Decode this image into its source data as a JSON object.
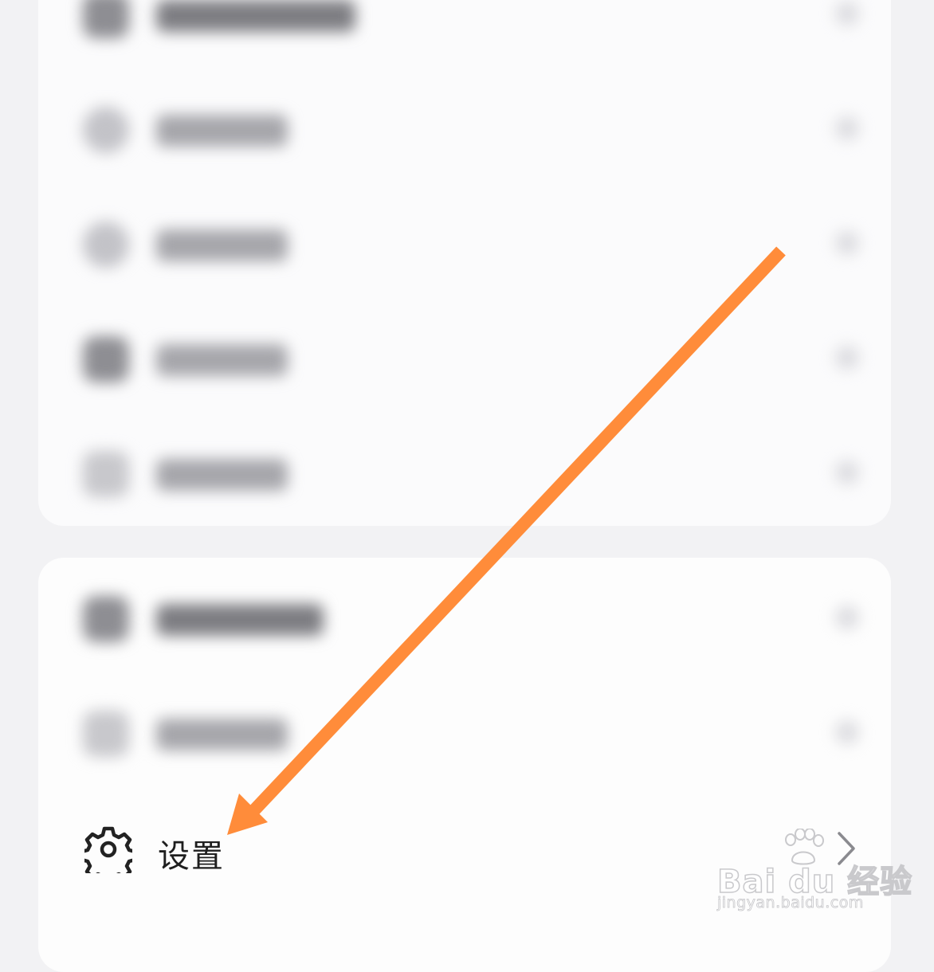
{
  "settings_item": {
    "label": "设置",
    "icon": "gear-icon",
    "chevron": "chevron-right-icon"
  },
  "annotation": {
    "type": "arrow",
    "color": "#ff8c3a",
    "points_to": "settings_item"
  },
  "watermark": {
    "brand": "Bai du 经验",
    "url": "jingyan.baidu.com"
  },
  "colors": {
    "background": "#f2f2f4",
    "card": "#fbfbfc",
    "text": "#1f1f1f",
    "arrow": "#ff8c3a"
  }
}
